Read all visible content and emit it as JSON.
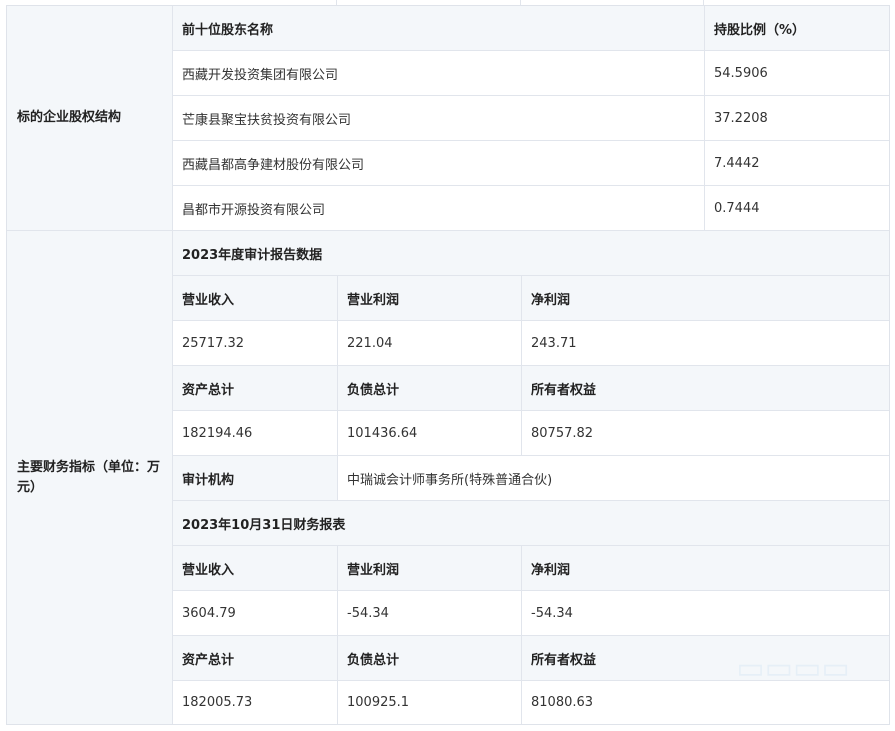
{
  "equity_section": {
    "label": "标的企业股权结构",
    "header": {
      "name": "前十位股东名称",
      "ratio": "持股比例（%）"
    },
    "rows": [
      {
        "name": "西藏开发投资集团有限公司",
        "ratio": "54.5906"
      },
      {
        "name": "芒康县聚宝扶贫投资有限公司",
        "ratio": "37.2208"
      },
      {
        "name": "西藏昌都高争建材股份有限公司",
        "ratio": "7.4442"
      },
      {
        "name": "昌都市开源投资有限公司",
        "ratio": "0.7444"
      }
    ]
  },
  "finance_section": {
    "label": "主要财务指标（单位：万元）",
    "audit_2023": {
      "title": "2023年度审计报告数据",
      "row1_headers": [
        "营业收入",
        "营业利润",
        "净利润"
      ],
      "row1_values": [
        "25717.32",
        "221.04",
        "243.71"
      ],
      "row2_headers": [
        "资产总计",
        "负债总计",
        "所有者权益"
      ],
      "row2_values": [
        "182194.46",
        "101436.64",
        "80757.82"
      ],
      "auditor_label": "审计机构",
      "auditor_value": "中瑞诚会计师事务所(特殊普通合伙)"
    },
    "report_2023_10_31": {
      "title": "2023年10月31日财务报表",
      "row1_headers": [
        "营业收入",
        "营业利润",
        "净利润"
      ],
      "row1_values": [
        "3604.79",
        "-54.34",
        "-54.34"
      ],
      "row2_headers": [
        "资产总计",
        "负债总计",
        "所有者权益"
      ],
      "row2_values": [
        "182005.73",
        "100925.1",
        "81080.63"
      ]
    }
  },
  "colors": {
    "header_bg": "#f4f7fa",
    "border": "#e1e5ec",
    "text": "#333333"
  }
}
